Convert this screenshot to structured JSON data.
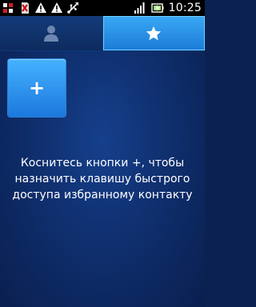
{
  "status_bar": {
    "time": "10:25",
    "icons_left": [
      "usb-debug-icon",
      "sim-icon",
      "warning-icon",
      "warning-icon",
      "usb-icon"
    ],
    "icons_right": [
      "network-signal-icon",
      "battery-icon"
    ]
  },
  "tabs": [
    {
      "name": "contacts",
      "icon": "person-icon",
      "selected": false
    },
    {
      "name": "favorites",
      "icon": "star-icon",
      "selected": true
    }
  ],
  "main": {
    "add_button_label": "+",
    "hint_text": "Коснитесь кнопки +, чтобы\nназначить клавишу быстрого\nдоступа избранному контакту"
  },
  "colors": {
    "accent": "#2b8ff0",
    "background": "#0b2150",
    "text": "#ffffff"
  }
}
